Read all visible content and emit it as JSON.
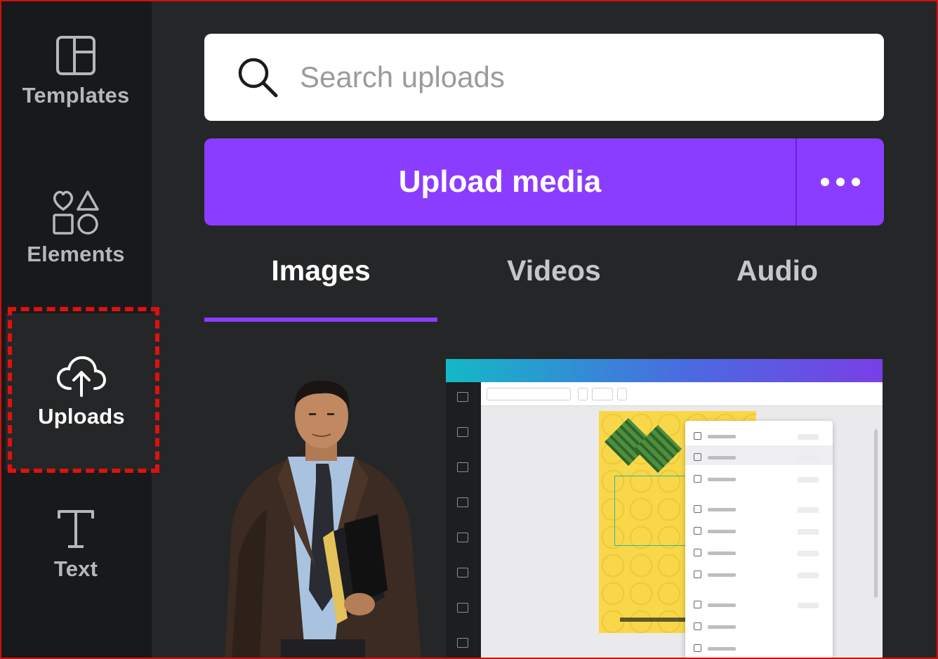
{
  "sidebar": {
    "items": [
      {
        "label": "Templates",
        "icon": "layout-icon"
      },
      {
        "label": "Elements",
        "icon": "shapes-icon"
      },
      {
        "label": "Uploads",
        "icon": "cloud-upload-icon",
        "active": true
      },
      {
        "label": "Text",
        "icon": "text-icon"
      }
    ]
  },
  "search": {
    "placeholder": "Search uploads",
    "value": ""
  },
  "upload": {
    "label": "Upload media",
    "more_icon": "ellipsis-icon"
  },
  "tabs": [
    {
      "label": "Images",
      "active": true
    },
    {
      "label": "Videos",
      "active": false
    },
    {
      "label": "Audio",
      "active": false
    }
  ],
  "colors": {
    "accent": "#8b3dff",
    "sidebar_bg": "#18191b",
    "panel_bg": "#252627",
    "highlight_border": "#e01010"
  }
}
